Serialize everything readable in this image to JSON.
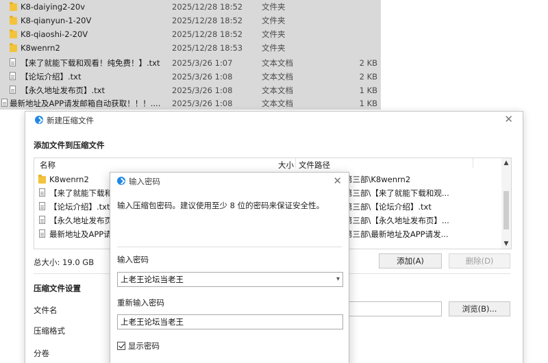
{
  "explorer": {
    "rows": [
      {
        "kind": "folder",
        "name": "K8-daiying2-20v",
        "date": "2025/12/28 18:52",
        "type": "文件夹",
        "size": ""
      },
      {
        "kind": "folder",
        "name": "K8-qianyun-1-20V",
        "date": "2025/12/28 18:52",
        "type": "文件夹",
        "size": ""
      },
      {
        "kind": "folder",
        "name": "K8-qiaoshi-2-20V",
        "date": "2025/12/28 18:52",
        "type": "文件夹",
        "size": ""
      },
      {
        "kind": "folder",
        "name": "K8wenrn2",
        "date": "2025/12/28 18:53",
        "type": "文件夹",
        "size": ""
      },
      {
        "kind": "file",
        "name": "【来了就能下载和观看！纯免费！】.txt",
        "date": "2025/3/26 1:07",
        "type": "文本文档",
        "size": "2 KB"
      },
      {
        "kind": "file",
        "name": "【论坛介绍】.txt",
        "date": "2025/3/26 1:08",
        "type": "文本文档",
        "size": "2 KB"
      },
      {
        "kind": "file",
        "name": "【永久地址发布页】.txt",
        "date": "2025/3/26 1:08",
        "type": "文本文档",
        "size": "1 KB"
      },
      {
        "kind": "file",
        "name": "最新地址及APP请发邮箱自动获取！！！....",
        "date": "2025/3/26 1:08",
        "type": "文本文档",
        "size": "1 KB"
      }
    ]
  },
  "compress_dialog": {
    "title": "新建压缩文件",
    "close_glyph": "✕",
    "add_section": "添加文件到压缩文件",
    "columns": {
      "name": "名称",
      "size": "大小",
      "path": "文件路径"
    },
    "files": [
      {
        "kind": "folder",
        "name": "K8wenrn2",
        "path": "热舞第三部\\K8wenrn2"
      },
      {
        "kind": "file",
        "name": "【来了就能下载和",
        "path": "热舞第三部\\【来了就能下载和观..."
      },
      {
        "kind": "file",
        "name": "【论坛介绍】.txt",
        "path": "热舞第三部\\【论坛介绍】.txt"
      },
      {
        "kind": "file",
        "name": "【永久地址发布页",
        "path": "热舞第三部\\【永久地址发布页】..."
      },
      {
        "kind": "file",
        "name": "最新地址及APP请发",
        "path": "热舞第三部\\最新地址及APP请发..."
      }
    ],
    "total_size": "总大小: 19.0 GB",
    "add_button": "添加(A)",
    "delete_button": "删除(D)",
    "settings_section": "压缩文件设置",
    "filename_label": "文件名",
    "format_label": "压缩格式",
    "split_label": "分卷",
    "browse_button": "浏览(B)..."
  },
  "password_dialog": {
    "title": "输入密码",
    "close_glyph": "✕",
    "message": "输入压缩包密码。建议使用至少 8 位的密码来保证安全性。",
    "password_label": "输入密码",
    "password_value": "上老王论坛当老王",
    "confirm_label": "重新输入密码",
    "confirm_value": "上老王论坛当老王",
    "show_password_label": "显示密码",
    "show_password_checked": true
  }
}
